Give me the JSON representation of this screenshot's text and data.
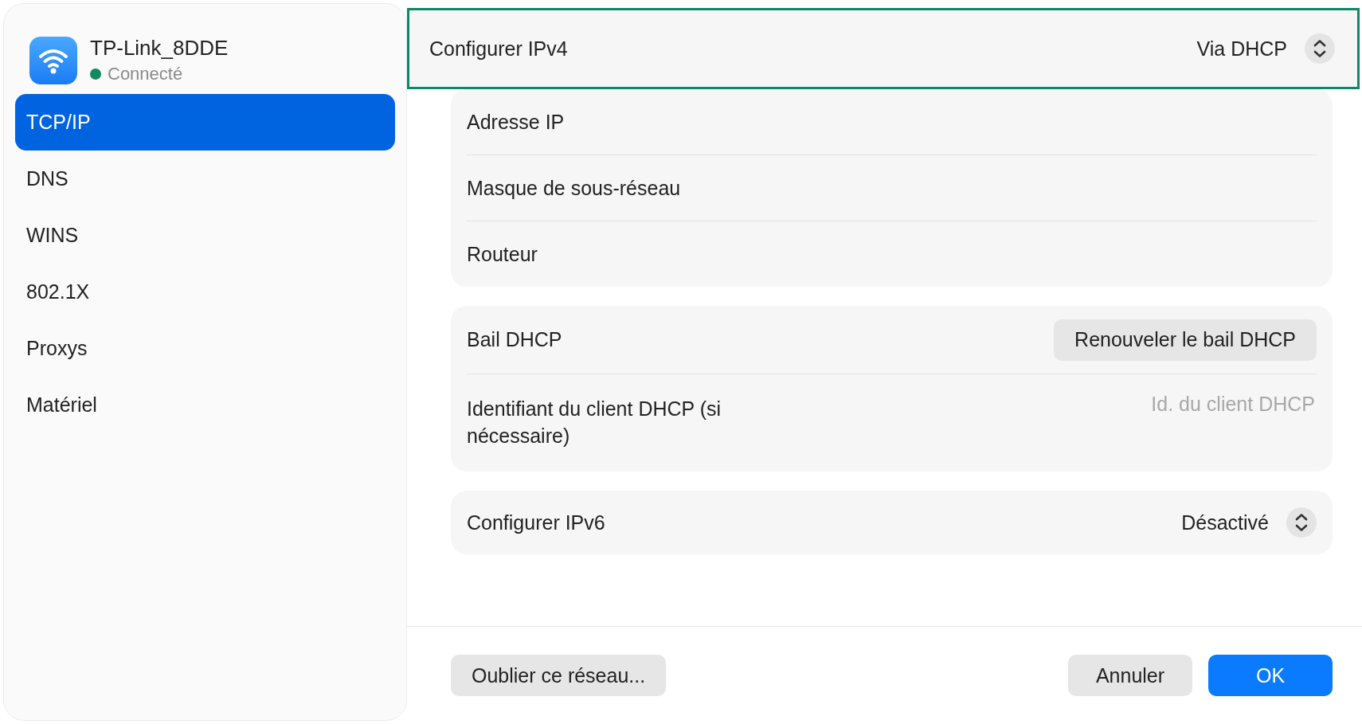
{
  "network": {
    "name": "TP-Link_8DDE",
    "status": "Connecté",
    "connected": true
  },
  "sidebar": {
    "items": [
      {
        "label": "TCP/IP",
        "selected": true
      },
      {
        "label": "DNS",
        "selected": false
      },
      {
        "label": "WINS",
        "selected": false
      },
      {
        "label": "802.1X",
        "selected": false
      },
      {
        "label": "Proxys",
        "selected": false
      },
      {
        "label": "Matériel",
        "selected": false
      }
    ]
  },
  "ipv4": {
    "label": "Configurer IPv4",
    "value": "Via DHCP",
    "highlighted": true
  },
  "address_rows": [
    {
      "label": "Adresse IP"
    },
    {
      "label": "Masque de sous-réseau"
    },
    {
      "label": "Routeur"
    }
  ],
  "dhcp_lease": {
    "label": "Bail DHCP",
    "button": "Renouveler le bail DHCP"
  },
  "client_id": {
    "label": "Identifiant du client DHCP (si nécessaire)",
    "placeholder": "Id. du client DHCP"
  },
  "ipv6": {
    "label": "Configurer IPv6",
    "value": "Désactivé"
  },
  "footer": {
    "forget": "Oublier ce réseau...",
    "cancel": "Annuler",
    "ok": "OK"
  }
}
